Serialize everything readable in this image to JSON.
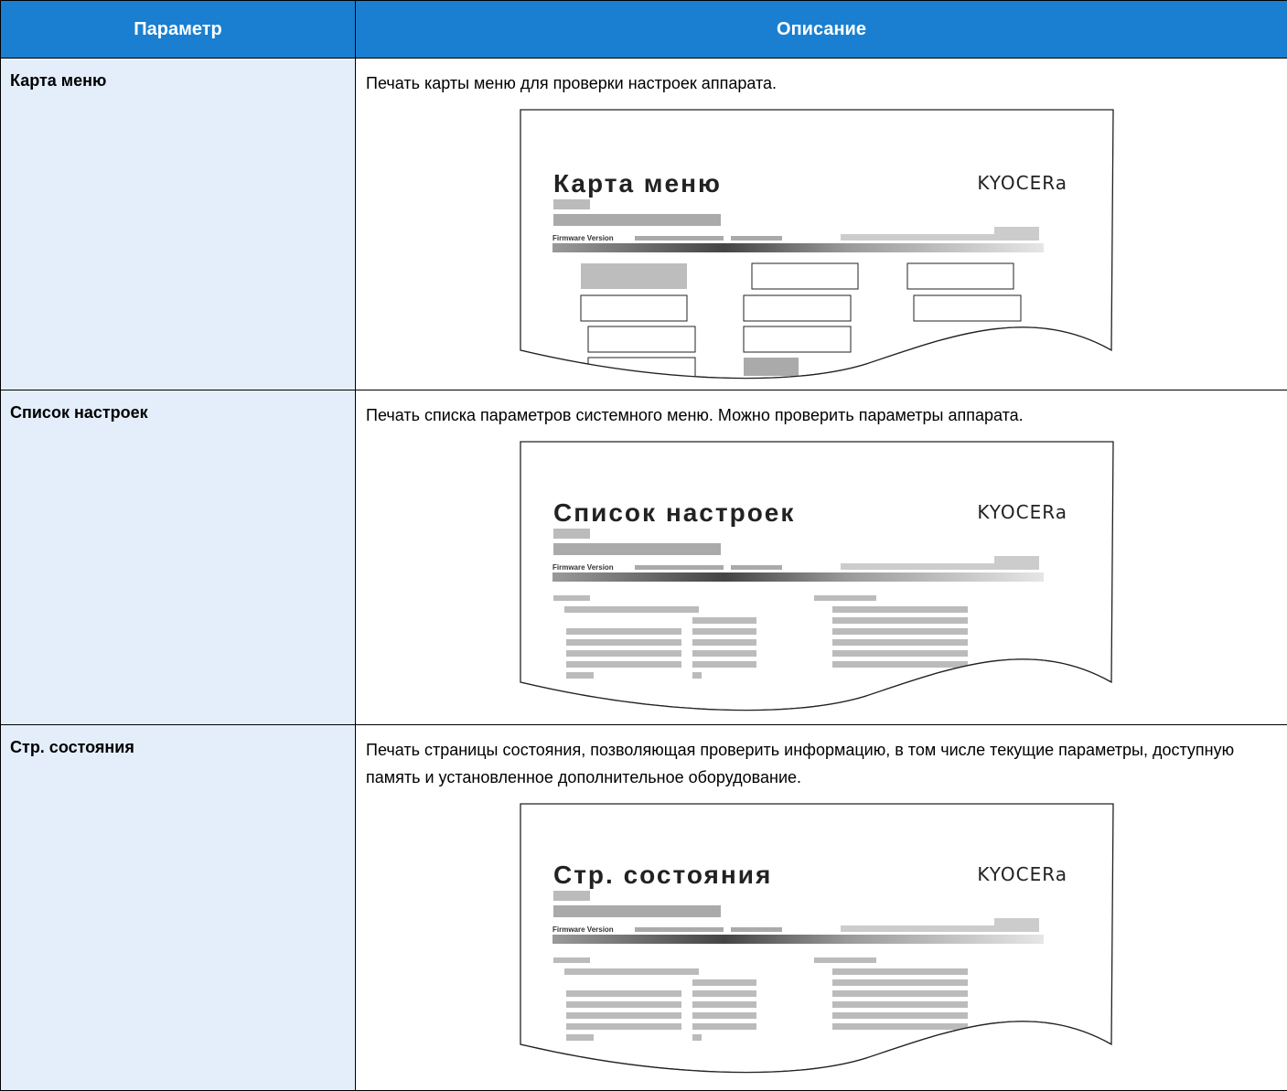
{
  "header": {
    "col_param": "Параметр",
    "col_desc": "Описание"
  },
  "rows": [
    {
      "param": "Карта меню",
      "desc": "Печать карты меню для проверки настроек аппарата.",
      "sample_title": "Карта меню",
      "logo": "KYOCERa",
      "fw_label": "Firmware Version"
    },
    {
      "param": "Список настроек",
      "desc": "Печать списка параметров системного меню. Можно проверить параметры аппарата.",
      "sample_title": "Список настроек",
      "logo": "KYOCERa",
      "fw_label": "Firmware Version"
    },
    {
      "param": "Стр. состояния",
      "desc": "Печать страницы состояния, позволяющая проверить информацию, в том числе текущие параметры, доступную память и установленное дополнительное оборудование.",
      "sample_title": "Стр. состояния",
      "logo": "KYOCERa",
      "fw_label": "Firmware Version"
    }
  ],
  "colors": {
    "header_bg": "#1a7fd0",
    "param_bg": "#e4eefb"
  }
}
